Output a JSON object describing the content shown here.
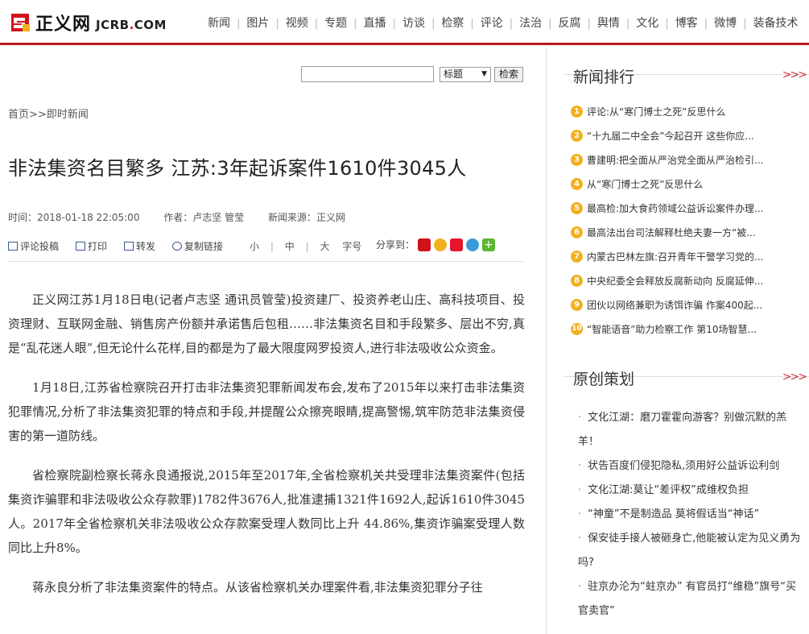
{
  "header": {
    "logo_cn": "正义网",
    "logo_en_a": "JCRB",
    "logo_en_dot": ".",
    "logo_en_b": "COM",
    "nav": [
      "新闻",
      "图片",
      "视频",
      "专题",
      "直播",
      "访谈",
      "检察",
      "评论",
      "法治",
      "反腐",
      "舆情",
      "文化",
      "博客",
      "微博",
      "装备技术"
    ]
  },
  "search": {
    "input_value": "",
    "select_value": "标题",
    "button_label": "检索"
  },
  "breadcrumb": {
    "home": "首页",
    "sep": ">>",
    "current": "即时新闻"
  },
  "article": {
    "title": "非法集资名目繁多 江苏:3年起诉案件1610件3045人",
    "time": "时间：2018-01-18 22:05:00",
    "author": "作者：卢志坚 管莹",
    "source": "新闻来源：正义网",
    "tools": {
      "comment": "评论投稿",
      "print": "打印",
      "forward": "转发",
      "copy": "复制链接"
    },
    "fontsize": {
      "small": "小",
      "medium": "中",
      "large": "大",
      "label": "字号"
    },
    "share_label": "分享到：",
    "paragraphs": [
      "正义网江苏1月18日电(记者卢志坚 通讯员管莹)投资建厂、投资养老山庄、高科技项目、投资理财、互联网金融、销售房产份额并承诺售后包租……非法集资名目和手段繁多、层出不穷,真是“乱花迷人眼”,但无论什么花样,目的都是为了最大限度网罗投资人,进行非法吸收公众资金。",
      "1月18日,江苏省检察院召开打击非法集资犯罪新闻发布会,发布了2015年以来打击非法集资犯罪情况,分析了非法集资犯罪的特点和手段,并提醒公众擦亮眼睛,提高警惕,筑牢防范非法集资侵害的第一道防线。",
      "省检察院副检察长蒋永良通报说,2015年至2017年,全省检察机关共受理非法集资案件(包括集资诈骗罪和非法吸收公众存款罪)1782件3676人,批准逮捕1321件1692人,起诉1610件3045人。2017年全省检察机关非法吸收公众存款案受理人数同比上升 44.86%,集资诈骗案受理人数同比上升8%。",
      "蒋永良分析了非法集资案件的特点。从该省检察机关办理案件看,非法集资犯罪分子往"
    ]
  },
  "sidebar": {
    "ranking": {
      "title": "新闻排行",
      "more": ">>>",
      "items": [
        {
          "num": "1",
          "text": "评论:从“寒门博士之死”反思什么"
        },
        {
          "num": "2",
          "text": "“十九届二中全会”今起召开 这些你应..."
        },
        {
          "num": "3",
          "text": "曹建明:把全面从严治党全面从严治检引..."
        },
        {
          "num": "4",
          "text": "从“寒门博士之死”反思什么"
        },
        {
          "num": "5",
          "text": "最高检:加大食药领域公益诉讼案件办理..."
        },
        {
          "num": "6",
          "text": "最高法出台司法解释杜绝夫妻一方“被..."
        },
        {
          "num": "7",
          "text": "内蒙古巴林左旗:召开青年干警学习党的..."
        },
        {
          "num": "8",
          "text": "中央纪委全会释放反腐新动向 反腐延伸..."
        },
        {
          "num": "9",
          "text": "团伙以网络兼职为诱饵诈骗 作案400起..."
        },
        {
          "num": "10",
          "text": "“智能语音”助力检察工作 第10场智慧..."
        }
      ]
    },
    "original": {
      "title": "原创策划",
      "more": ">>>",
      "items": [
        "文化江湖：磨刀霍霍向游客？别做沉默的羔羊！",
        "状告百度们侵犯隐私,须用好公益诉讼利剑",
        "文化江湖:莫让“差评权”成维权负担",
        "“神童”不是制造品 莫将假话当“神话”",
        "保安徒手接人被砸身亡,他能被认定为见义勇为吗?",
        "驻京办沦为“蛀京办” 有官员打“维稳”旗号“买官卖官”"
      ]
    }
  },
  "colors": {
    "brand_red": "#b8181c",
    "rank_badge": "#f2b01e"
  }
}
